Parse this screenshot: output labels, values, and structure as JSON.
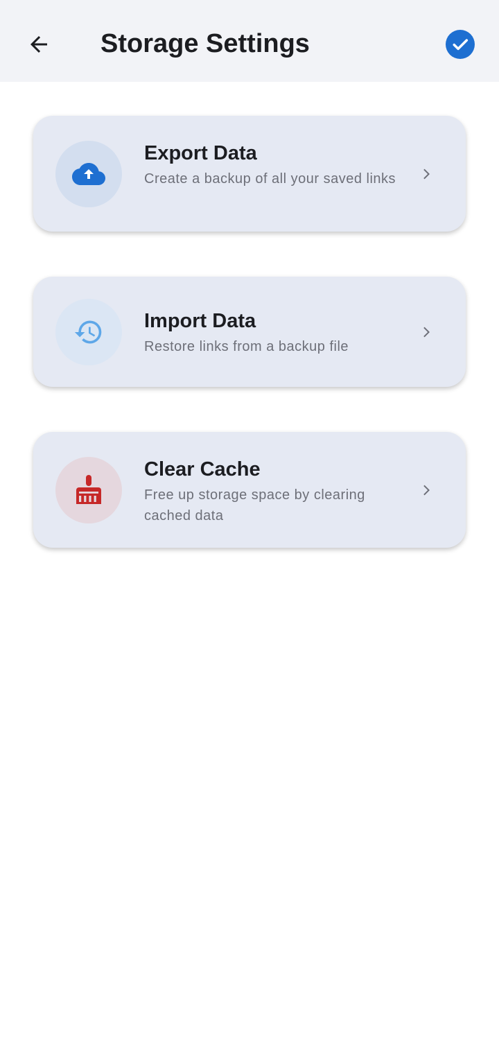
{
  "appbar": {
    "title": "Storage Settings",
    "back_icon": "arrow-left-icon",
    "confirm_icon": "check-circle-icon",
    "accent": "#1e6fd1"
  },
  "items": [
    {
      "title": "Export Data",
      "subtitle": "Create a backup of all your saved links",
      "icon": "cloud-upload-icon",
      "icon_color": "#1e6fd1"
    },
    {
      "title": "Import Data",
      "subtitle": "Restore links from a backup file",
      "icon": "history-restore-icon",
      "icon_color": "#5ea7e8"
    },
    {
      "title": "Clear Cache",
      "subtitle": "Free up storage space by clearing cached data",
      "icon": "broom-icon",
      "icon_color": "#c62828"
    }
  ]
}
